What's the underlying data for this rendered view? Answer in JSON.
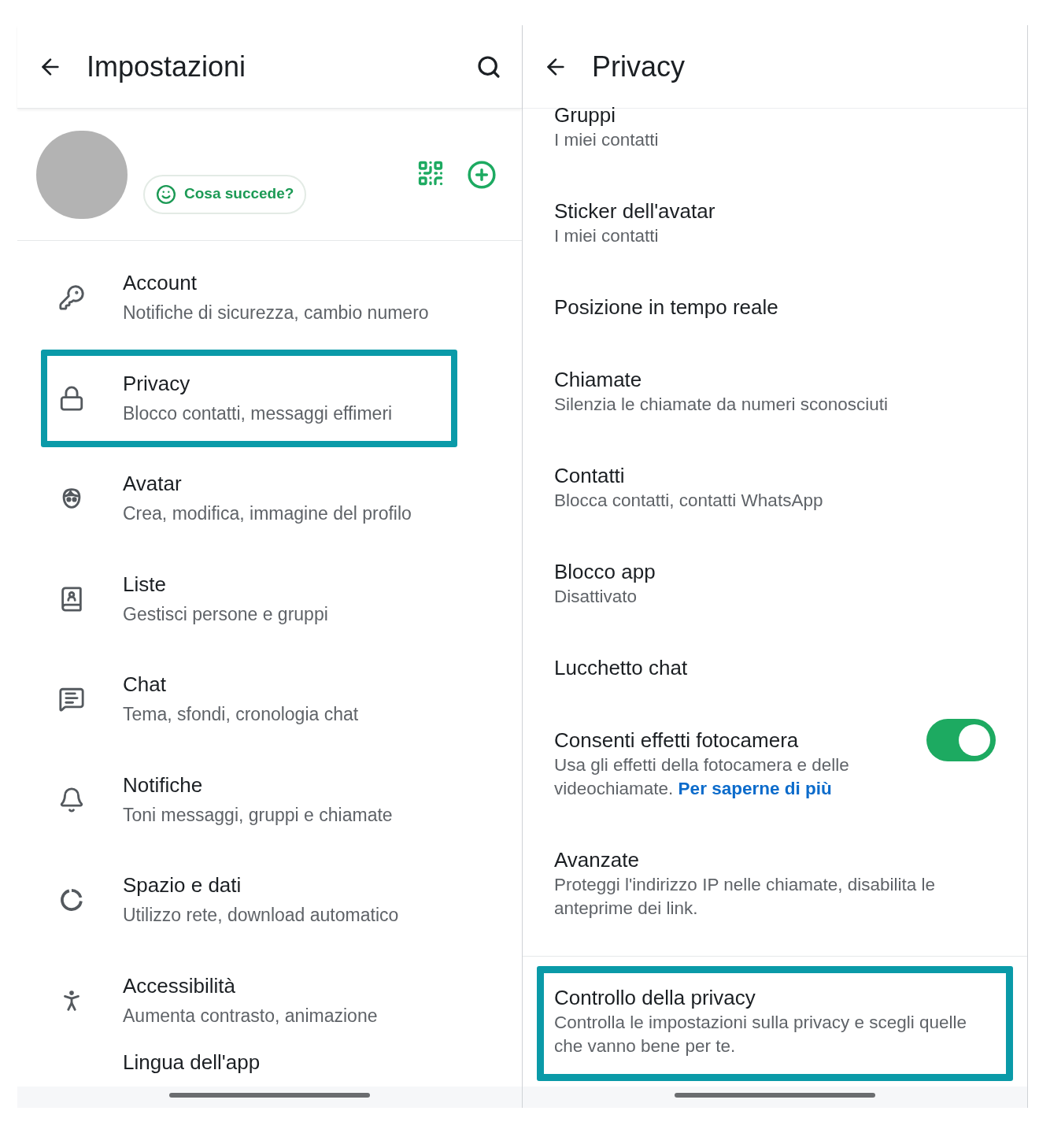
{
  "settings": {
    "title": "Impostazioni",
    "status_button": "Cosa succede?",
    "items": [
      {
        "title": "Account",
        "subtitle": "Notifiche di sicurezza, cambio numero",
        "highlighted": false
      },
      {
        "title": "Privacy",
        "subtitle": "Blocco contatti, messaggi effimeri",
        "highlighted": true
      },
      {
        "title": "Avatar",
        "subtitle": "Crea, modifica, immagine del profilo",
        "highlighted": false
      },
      {
        "title": "Liste",
        "subtitle": "Gestisci persone e gruppi",
        "highlighted": false
      },
      {
        "title": "Chat",
        "subtitle": "Tema, sfondi, cronologia chat",
        "highlighted": false
      },
      {
        "title": "Notifiche",
        "subtitle": "Toni messaggi, gruppi e chiamate",
        "highlighted": false
      },
      {
        "title": "Spazio e dati",
        "subtitle": "Utilizzo rete, download automatico",
        "highlighted": false
      },
      {
        "title": "Accessibilità",
        "subtitle": "Aumenta contrasto, animazione",
        "highlighted": false
      },
      {
        "title": "Lingua dell'app",
        "highlighted": false
      }
    ]
  },
  "privacy": {
    "title": "Privacy",
    "items": [
      {
        "kind": "row",
        "title": "Gruppi",
        "subtitle": "I miei contatti",
        "highlighted": false
      },
      {
        "kind": "row",
        "title": "Sticker dell'avatar",
        "subtitle": "I miei contatti",
        "highlighted": false
      },
      {
        "kind": "row",
        "title": "Posizione in tempo reale",
        "highlighted": false
      },
      {
        "kind": "row",
        "title": "Chiamate",
        "subtitle": "Silenzia le chiamate da numeri sconosciuti",
        "highlighted": false
      },
      {
        "kind": "row",
        "title": "Contatti",
        "subtitle": "Blocca contatti, contatti WhatsApp",
        "highlighted": false
      },
      {
        "kind": "row",
        "title": "Blocco app",
        "subtitle": "Disattivato",
        "highlighted": false
      },
      {
        "kind": "row",
        "title": "Lucchetto chat",
        "highlighted": false
      },
      {
        "kind": "toggle",
        "title": "Consenti effetti fotocamera",
        "subtitle": "Usa gli effetti della fotocamera e delle videochiamate.",
        "link": "Per saperne di più",
        "on": true,
        "highlighted": false
      },
      {
        "kind": "row",
        "title": "Avanzate",
        "subtitle": "Proteggi l'indirizzo IP nelle chiamate, disabilita le anteprime dei link.",
        "highlighted": false
      },
      {
        "kind": "divider"
      },
      {
        "kind": "row",
        "title": "Controllo della privacy",
        "subtitle": "Controlla le impostazioni sulla privacy e scegli quelle che vanno bene per te.",
        "highlighted": true
      }
    ]
  }
}
